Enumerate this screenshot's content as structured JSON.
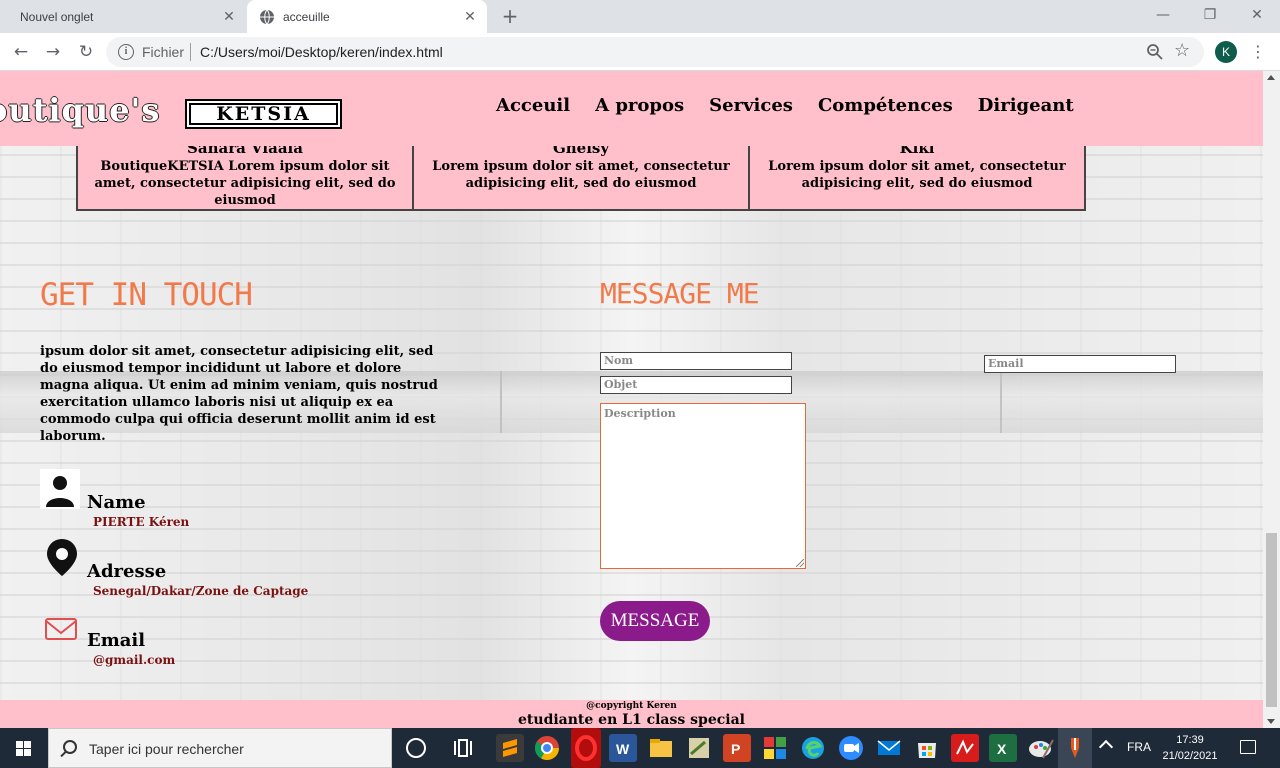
{
  "browser": {
    "tabs": [
      {
        "title": "Nouvel onglet",
        "active": false
      },
      {
        "title": "acceuille",
        "active": true
      }
    ],
    "address": {
      "scheme_label": "Fichier",
      "url": "C:/Users/moi/Desktop/keren/index.html"
    },
    "profile_initial": "K"
  },
  "site": {
    "brand_left": "outique's",
    "brand_box": "KETSIA",
    "nav": [
      "Acceuil",
      "A propos",
      "Services",
      "Compétences",
      "Dirigeant"
    ],
    "team": [
      {
        "name": "Sanara Viaaia",
        "text": "BoutiqueKETSIA Lorem ipsum dolor sit amet, consectetur adipisicing elit, sed do eiusmod"
      },
      {
        "name": "Gneisy",
        "text": "Lorem ipsum dolor sit amet, consectetur adipisicing elit, sed do eiusmod"
      },
      {
        "name": "Kiki",
        "text": "Lorem ipsum dolor sit amet, consectetur adipisicing elit, sed do eiusmod"
      }
    ],
    "touch": {
      "heading": "GET IN TOUCH",
      "text": "ipsum dolor sit amet, consectetur adipisicing elit, sed do eiusmod tempor incididunt ut labore et dolore magna aliqua. Ut enim ad minim veniam, quis nostrud exercitation ullamco laboris nisi ut aliquip ex ea commodo culpa qui officia deserunt mollit anim id est laborum.",
      "name_label": "Name",
      "name_value": "PIERTE Kéren",
      "address_label": "Adresse",
      "address_value": "Senegal/Dakar/Zone de Captage",
      "email_label": "Email",
      "email_value": "@gmail.com"
    },
    "form": {
      "heading": "MESSAGE ME",
      "nom_placeholder": "Nom",
      "email_placeholder": "Email",
      "objet_placeholder": "Objet",
      "description_placeholder": "Description",
      "submit_label": "MESSAGE"
    },
    "footer": {
      "copyright": "@copyright Keren",
      "student": "etudiante en L1 class special"
    },
    "colors": {
      "pink": "#ffc0cb",
      "accent_orange": "#f27a4a",
      "button_purple": "#8b1a8b"
    }
  },
  "taskbar": {
    "search_placeholder": "Taper ici pour rechercher",
    "language": "FRA",
    "time": "17:39",
    "date": "21/02/2021",
    "apps": [
      "sublime-text",
      "chrome",
      "opera",
      "word",
      "file-explorer",
      "gimp",
      "powerpoint",
      "apps-grid",
      "edge",
      "zoom",
      "mail",
      "store",
      "pdf-reader",
      "excel",
      "paint",
      "active-app"
    ]
  }
}
